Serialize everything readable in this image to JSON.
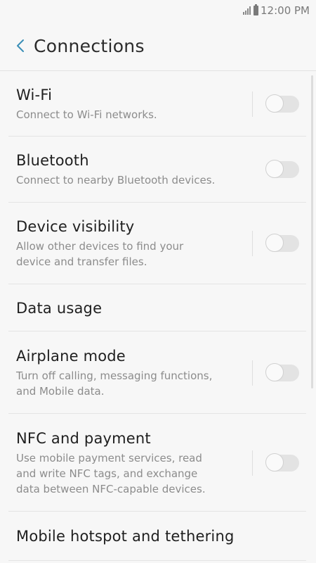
{
  "status_bar": {
    "time": "12:00 PM"
  },
  "header": {
    "title": "Connections",
    "back_icon": "chevron-left-icon"
  },
  "items": [
    {
      "title": "Wi-Fi",
      "desc_lines": [
        "Connect to Wi-Fi networks."
      ],
      "has_toggle": true,
      "toggle_on": false
    },
    {
      "title": "Bluetooth",
      "desc_lines": [
        "Connect to nearby Bluetooth devices."
      ],
      "has_toggle": true,
      "toggle_on": false
    },
    {
      "title": "Device visibility",
      "desc_lines": [
        "Allow other devices to find your",
        "device and transfer files."
      ],
      "has_toggle": true,
      "toggle_on": false
    },
    {
      "title": "Data usage",
      "desc_lines": [],
      "has_toggle": false
    },
    {
      "title": "Airplane mode",
      "desc_lines": [
        "Turn off calling, messaging functions,",
        "and Mobile data."
      ],
      "has_toggle": true,
      "toggle_on": false
    },
    {
      "title": "NFC and payment",
      "desc_lines": [
        "Use mobile payment services, read",
        "and write NFC tags, and exchange",
        "data between NFC-capable devices."
      ],
      "has_toggle": true,
      "toggle_on": false
    },
    {
      "title": "Mobile hotspot and tethering",
      "desc_lines": [],
      "has_toggle": false
    }
  ],
  "colors": {
    "accent": "#3a8fb7",
    "background": "#f7f7f7",
    "toggle_off": "#e3e3e3"
  }
}
